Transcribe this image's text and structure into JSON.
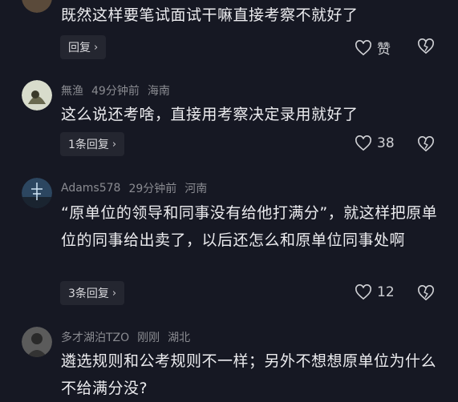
{
  "comments": [
    {
      "text": "既然这样要笔试面试干嘛直接考察不就好了",
      "reply_label": "回复",
      "like_label": "赞"
    },
    {
      "username": "無渔",
      "time": "49分钟前",
      "location": "海南",
      "text": "这么说还考啥，直接用考察决定录用就好了",
      "reply_label": "1条回复",
      "like_count": "38"
    },
    {
      "username": "Adams578",
      "time": "29分钟前",
      "location": "河南",
      "text": "“原单位的领导和同事没有给他打满分”，就这样把原单位的同事给出卖了，以后还怎么和原单位同事处啊",
      "reply_label": "3条回复",
      "like_count": "12"
    },
    {
      "username": "多才湖泊TZO",
      "time": "刚刚",
      "location": "湖北",
      "text": "遴选规则和公考规则不一样；另外不想想原单位为什么不给满分没?"
    }
  ],
  "colors": {
    "background": "#161823",
    "text": "#ececef",
    "meta": "#8a8b91",
    "pill": "#242630"
  },
  "icons": [
    "chevron-right-icon",
    "heart-icon",
    "broken-heart-icon"
  ]
}
